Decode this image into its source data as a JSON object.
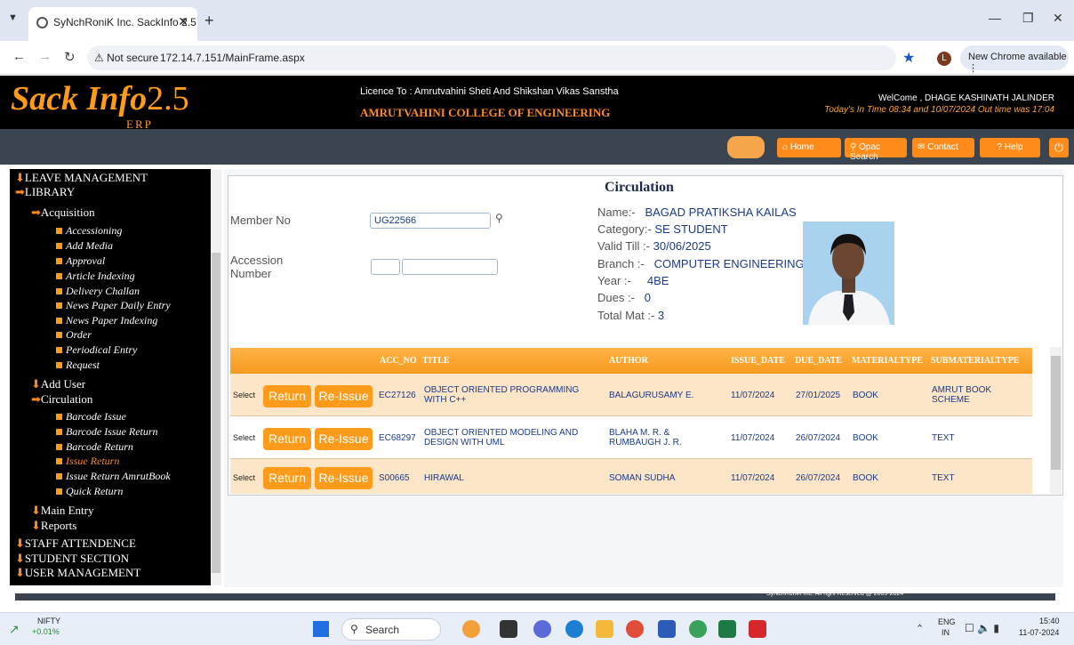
{
  "browser": {
    "tab_title": "SyNchRoniK Inc. SackInfo 2.5",
    "not_secure": "Not secure",
    "url": "172.14.7.151/MainFrame.aspx",
    "chrome_update": "New Chrome available",
    "avatar_letter": "L"
  },
  "header": {
    "logo_main": "Sack",
    "logo_rest": " Info",
    "logo_version": "2.5",
    "logo_sub": "ERP",
    "licence": "Licence To : Amrutvahini Sheti And Shikshan Vikas Sanstha",
    "college": "AMRUTVAHINI COLLEGE OF ENGINEERING",
    "welcome": "WelCome , DHAGE KASHINATH JALINDER",
    "time_info": "Today's In Time 08:34 and 10/07/2024 Out time was 17:04"
  },
  "nav": {
    "home": "Home",
    "opac": "Opac Search",
    "contact": "Contact",
    "help": "? Help"
  },
  "sidebar": {
    "leave": "LEAVE MANAGEMENT",
    "library": "LIBRARY",
    "acquisition": "Acquisition",
    "acq_items": [
      "Accessioning",
      "Add Media",
      "Approval",
      "Article Indexing",
      "Delivery Challan",
      "News Paper Daily Entry",
      "News Paper Indexing",
      "Order",
      "Periodical Entry",
      "Request"
    ],
    "add_user": "Add User",
    "circulation": "Circulation",
    "circ_items": [
      "Barcode Issue",
      "Barcode Issue Return",
      "Barcode Return",
      "Issue Return",
      "Issue Return AmrutBook",
      "Quick Return"
    ],
    "main_entry": "Main Entry",
    "reports": "Reports",
    "staff": "STAFF ATTENDENCE",
    "student": "STUDENT SECTION",
    "user_mgmt": "USER MANAGEMENT"
  },
  "form": {
    "title": "Circulation",
    "member_no_label": "Member No",
    "member_no": "UG22566",
    "accession_label_1": "Accession",
    "accession_label_2": "Number",
    "name_label": "Name:-",
    "name": "BAGAD PRATIKSHA KAILAS",
    "category_label": "Category:-",
    "category": "SE STUDENT",
    "valid_label": "Valid Till :-",
    "valid": "30/06/2025",
    "branch_label": "Branch :-",
    "branch": "COMPUTER ENGINEERING",
    "year_label": "Year :-",
    "year": "4BE",
    "dues_label": "Dues :-",
    "dues": "0",
    "total_label": "Total Mat :-",
    "total": "3"
  },
  "table": {
    "headers": [
      "ACC_NO",
      "TITLE",
      "AUTHOR",
      "ISSUE_DATE",
      "DUE_DATE",
      "MATERIALTYPE",
      "SUBMATERIALTYPE"
    ],
    "select_label": "Select",
    "return_label": "Return",
    "reissue_label": "Re-Issue",
    "rows": [
      {
        "acc": "EC27126",
        "title": "OBJECT ORIENTED PROGRAMMING WITH C++",
        "author": "BALAGURUSAMY E.",
        "issue": "11/07/2024",
        "due": "27/01/2025",
        "mtype": "BOOK",
        "subtype": "AMRUT BOOK SCHEME"
      },
      {
        "acc": "EC68297",
        "title": "OBJECT ORIENTED MODELING AND DESIGN WITH UML",
        "author": "BLAHA M. R. & RUMBAUGH J. R.",
        "issue": "11/07/2024",
        "due": "26/07/2024",
        "mtype": "BOOK",
        "subtype": "TEXT"
      },
      {
        "acc": "S00665",
        "title": "HIRAWAL",
        "author": "SOMAN SUDHA",
        "issue": "11/07/2024",
        "due": "26/07/2024",
        "mtype": "BOOK",
        "subtype": "TEXT"
      }
    ]
  },
  "footer": {
    "text": "SyNchRoniK Inc. All right Reserved @ 2009-2024"
  },
  "taskbar": {
    "stock_name": "NIFTY",
    "stock_change": "+0.01%",
    "search": "Search",
    "lang1": "ENG",
    "lang2": "IN",
    "time": "15:40",
    "date": "11-07-2024"
  }
}
